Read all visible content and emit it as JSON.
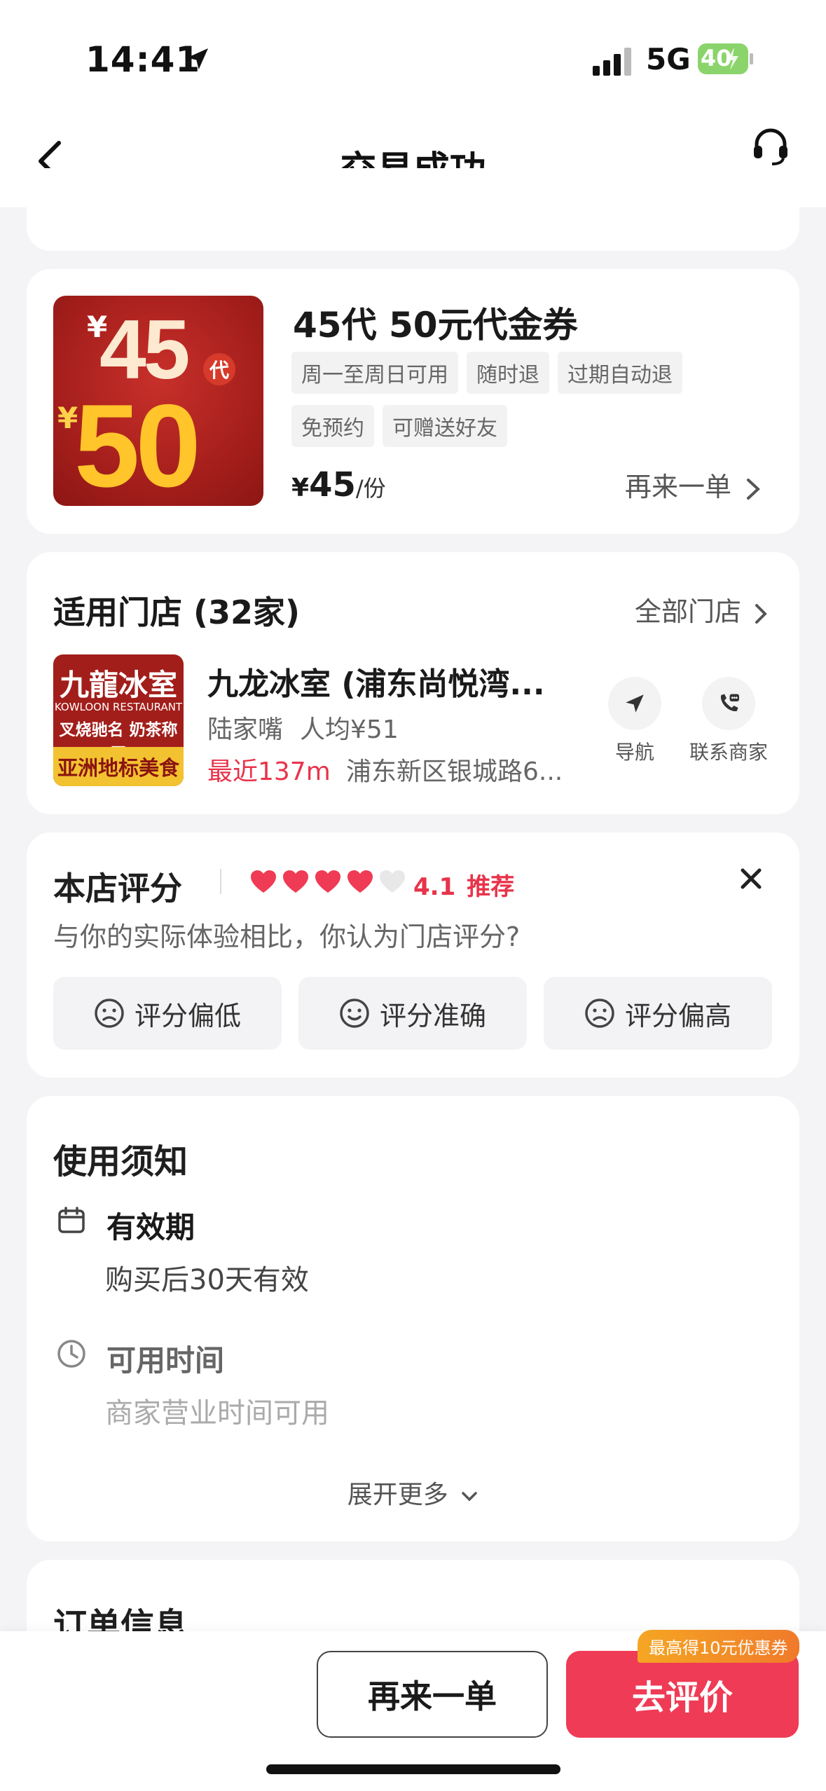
{
  "status_bar": {
    "time": "14:41",
    "network": "5G",
    "battery": "40"
  },
  "nav": {
    "title": "交易成功",
    "service_label": "客服"
  },
  "product": {
    "image": {
      "top_small": "¥",
      "top_num": "45",
      "top_suffix": "代",
      "bottom_small": "¥",
      "bottom_num": "50"
    },
    "title": "45代 50元代金券",
    "tags": [
      "周一至周日可用",
      "随时退",
      "过期自动退",
      "免预约",
      "可赠送好友"
    ],
    "price_symbol": "¥",
    "price": "45",
    "price_unit": "/份",
    "again_label": "再来一单"
  },
  "store": {
    "section_title": "适用门店 (32家)",
    "all_label": "全部门店",
    "logo": {
      "line1": "九龍冰室",
      "line2": "KOWLOON RESTAURANT",
      "line3": "叉烧驰名 奶茶称王",
      "line4": "亚洲地标美食"
    },
    "name": "九龙冰室 (浦东尚悦湾...",
    "area": "陆家嘴",
    "avg_price": "人均¥51",
    "distance": "最近137m",
    "address": "浦东新区银城路6...",
    "nav_label": "导航",
    "contact_label": "联系商家"
  },
  "rating": {
    "title": "本店评分",
    "score": "4.1",
    "score_label": "推荐",
    "filled_hearts": 4,
    "total_hearts": 5,
    "question": "与你的实际体验相比，你认为门店评分?",
    "options": [
      "评分偏低",
      "评分准确",
      "评分偏高"
    ]
  },
  "notes": {
    "title": "使用须知",
    "validity_head": "有效期",
    "validity_body": "购买后30天有效",
    "time_head": "可用时间",
    "time_body": "商家营业时间可用",
    "expand_label": "展开更多"
  },
  "order": {
    "title": "订单信息"
  },
  "bottom": {
    "again_label": "再来一单",
    "review_label": "去评价",
    "badge_label": "最高得10元优惠券"
  },
  "colors": {
    "accent": "#ef3b55",
    "price_red": "#e8334a",
    "badge_orange": "#f5a623",
    "page_bg": "#f4f4f6"
  }
}
